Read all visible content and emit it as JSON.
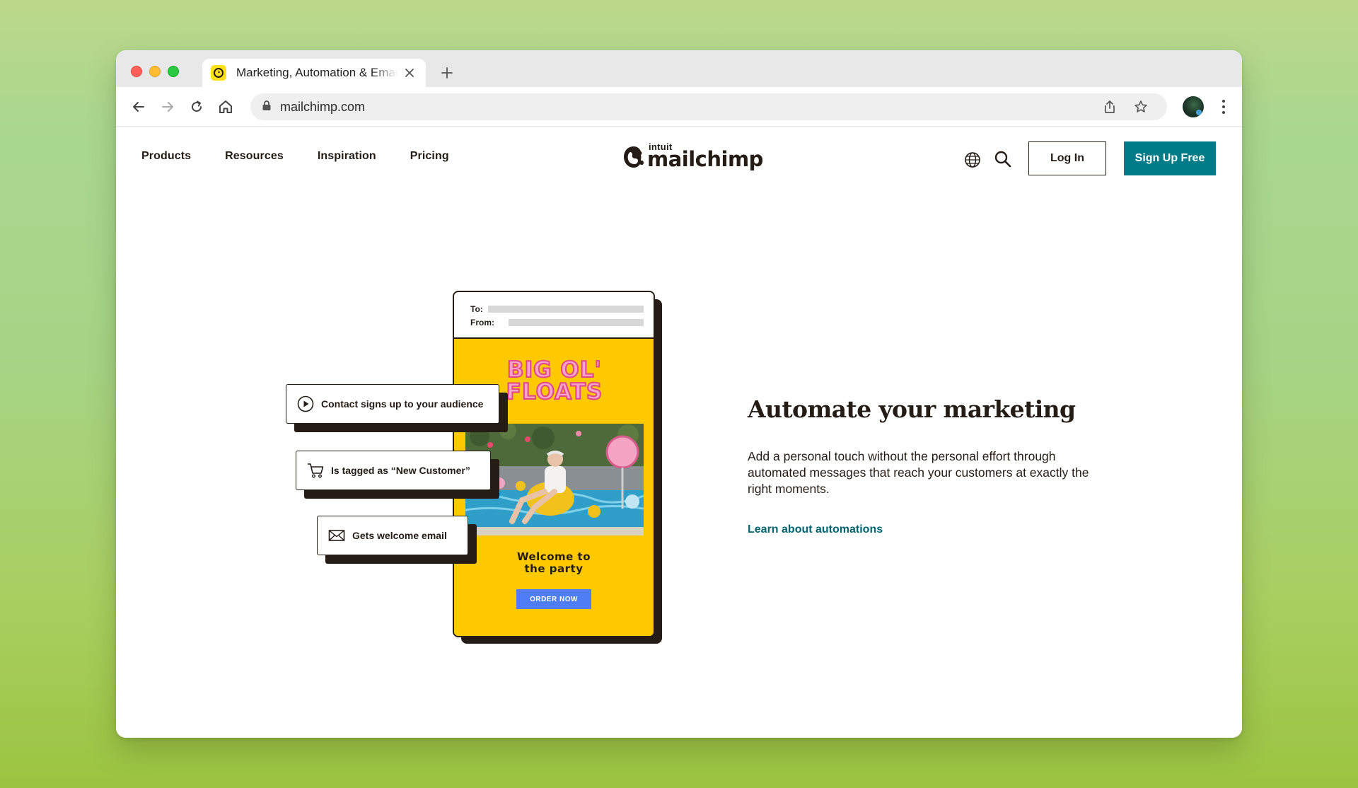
{
  "browser": {
    "tab_title": "Marketing, Automation & Email Marketing Platform",
    "url": "mailchimp.com"
  },
  "site": {
    "nav": [
      "Products",
      "Resources",
      "Inspiration",
      "Pricing"
    ],
    "logo_top": "intuit",
    "logo_word": "mailchimp",
    "login_label": "Log In",
    "signup_label": "Sign Up Free"
  },
  "illustration": {
    "to_label": "To:",
    "from_label": "From:",
    "brand_line1": "BIG OL'",
    "brand_line2": "FLOATS",
    "welcome_line1": "Welcome to",
    "welcome_line2": "the party",
    "order_label": "ORDER NOW",
    "steps": [
      {
        "label": "Contact signs up to your audience",
        "icon": "play-icon"
      },
      {
        "label": "Is tagged as “New Customer”",
        "icon": "cart-icon"
      },
      {
        "label": "Gets welcome email",
        "icon": "envelope-icon"
      }
    ]
  },
  "hero": {
    "headline": "Automate your marketing",
    "description": "Add a personal touch without the personal effort through automated messages that reach your customers at exactly the right moments.",
    "link_label": "Learn about automations"
  },
  "colors": {
    "brand_teal": "#007c89",
    "mailchimp_yellow": "#ffe01b",
    "ink": "#241c15",
    "order_blue": "#4f7df3"
  }
}
